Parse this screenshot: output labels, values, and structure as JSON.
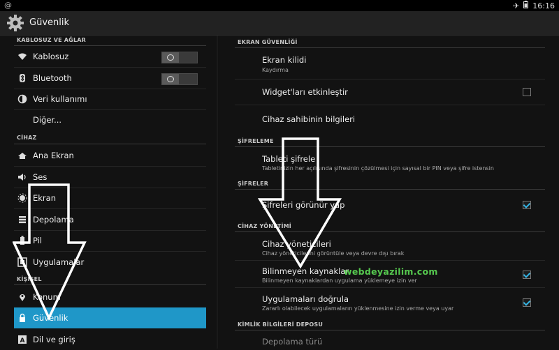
{
  "status_bar": {
    "left_icon": "notification-icon",
    "airplane_icon": "airplane-icon",
    "battery_icon": "battery-icon",
    "time": "16:16"
  },
  "action_bar": {
    "icon": "gear-icon",
    "title": "Güvenlik"
  },
  "left": {
    "sections": [
      {
        "header": "KABLOSUZ VE AĞLAR",
        "items": [
          {
            "icon": "wifi-icon",
            "label": "Kablosuz",
            "toggle": "off"
          },
          {
            "icon": "bluetooth-icon",
            "label": "Bluetooth",
            "toggle": "off"
          },
          {
            "icon": "data-usage-icon",
            "label": "Veri kullanımı"
          },
          {
            "icon": "",
            "label": "Diğer..."
          }
        ]
      },
      {
        "header": "CİHAZ",
        "items": [
          {
            "icon": "home-icon",
            "label": "Ana Ekran"
          },
          {
            "icon": "sound-icon",
            "label": "Ses"
          },
          {
            "icon": "display-icon",
            "label": "Ekran"
          },
          {
            "icon": "storage-icon",
            "label": "Depolama"
          },
          {
            "icon": "battery-icon",
            "label": "Pil"
          },
          {
            "icon": "apps-icon",
            "label": "Uygulamalar"
          }
        ]
      },
      {
        "header": "KİŞİSEL",
        "items": [
          {
            "icon": "location-icon",
            "label": "Konum"
          },
          {
            "icon": "lock-icon",
            "label": "Güvenlik",
            "active": true
          },
          {
            "icon": "language-icon",
            "label": "Dil ve giriş"
          }
        ]
      }
    ]
  },
  "right": {
    "sections": [
      {
        "header": "EKRAN GÜVENLİĞİ",
        "items": [
          {
            "title": "Ekran kilidi",
            "subtitle": "Kaydırma"
          },
          {
            "title": "Widget'ları etkinleştir",
            "checkbox": false
          },
          {
            "title": "Cihaz sahibinin bilgileri"
          }
        ]
      },
      {
        "header": "ŞİFRELEME",
        "items": [
          {
            "title": "Tableti şifrele",
            "subtitle": "Tabletinizin her açılışında şifresinin çözülmesi için sayısal bir PIN veya şifre istensin"
          }
        ]
      },
      {
        "header": "ŞİFRELER",
        "items": [
          {
            "title": "Şifreleri görünür yap",
            "checkbox": true
          }
        ]
      },
      {
        "header": "CİHAZ YÖNETİMİ",
        "items": [
          {
            "title": "Cihaz yöneticileri",
            "subtitle": "Cihaz yöneticilerini görüntüle veya devre dışı bırak"
          },
          {
            "title": "Bilinmeyen kaynaklar",
            "subtitle": "Bilinmeyen kaynaklardan uygulama yüklemeye izin ver",
            "checkbox": true
          },
          {
            "title": "Uygulamaları doğrula",
            "subtitle": "Zararlı olabilecek uygulamaların yüklenmesine izin verme veya uyar",
            "checkbox": true
          }
        ]
      },
      {
        "header": "KİMLİK BİLGİLERİ DEPOSU",
        "items": [
          {
            "title": "Depolama türü",
            "disabled": true
          }
        ]
      }
    ]
  },
  "overlay": {
    "watermark": "webdeyazilim.com"
  },
  "colors": {
    "accent": "#1f97c8",
    "checkbox_tick": "#35b5e5",
    "watermark": "#56c94f",
    "background": "#121212"
  }
}
